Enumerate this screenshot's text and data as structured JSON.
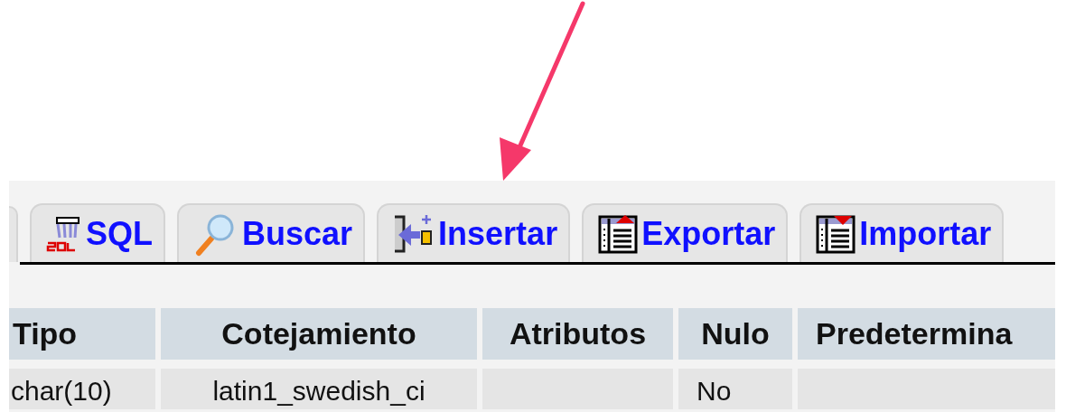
{
  "tabs": [
    {
      "label": "SQL",
      "kind": "sql",
      "selected": false
    },
    {
      "label": "Buscar",
      "kind": "search",
      "selected": false
    },
    {
      "label": "Insertar",
      "kind": "insert",
      "selected": false
    },
    {
      "label": "Exportar",
      "kind": "export",
      "selected": false
    },
    {
      "label": "Importar",
      "kind": "import",
      "selected": false
    }
  ],
  "table": {
    "columns": [
      "Tipo",
      "Cotejamiento",
      "Atributos",
      "Nulo",
      "Predetermina"
    ],
    "rows": [
      [
        "char(10)",
        "latin1_swedish_ci",
        "",
        "No",
        ""
      ]
    ]
  }
}
